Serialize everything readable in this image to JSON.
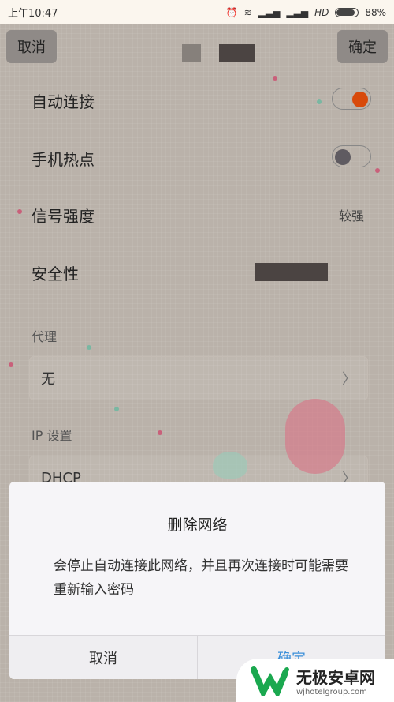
{
  "status_bar": {
    "time": "上午10:47",
    "network": "HD",
    "battery": "88%",
    "battery_level": 88
  },
  "header": {
    "cancel": "取消",
    "confirm": "确定"
  },
  "settings": {
    "auto_connect": {
      "label": "自动连接",
      "on": true,
      "color": "#d84a0b"
    },
    "hotspot": {
      "label": "手机热点",
      "on": false
    },
    "signal": {
      "label": "信号强度",
      "value": "较强"
    },
    "security": {
      "label": "安全性"
    },
    "proxy": {
      "label": "代理",
      "value": "无"
    },
    "ip": {
      "label": "IP 设置",
      "value": "DHCP"
    }
  },
  "dialog": {
    "title": "删除网络",
    "message": "会停止自动连接此网络，并且再次连接时可能需要重新输入密码",
    "cancel": "取消",
    "confirm": "确定",
    "confirm_color": "#3b8fd9"
  },
  "watermark": {
    "name": "无极安卓网",
    "url": "wjhotelgroup.com"
  }
}
